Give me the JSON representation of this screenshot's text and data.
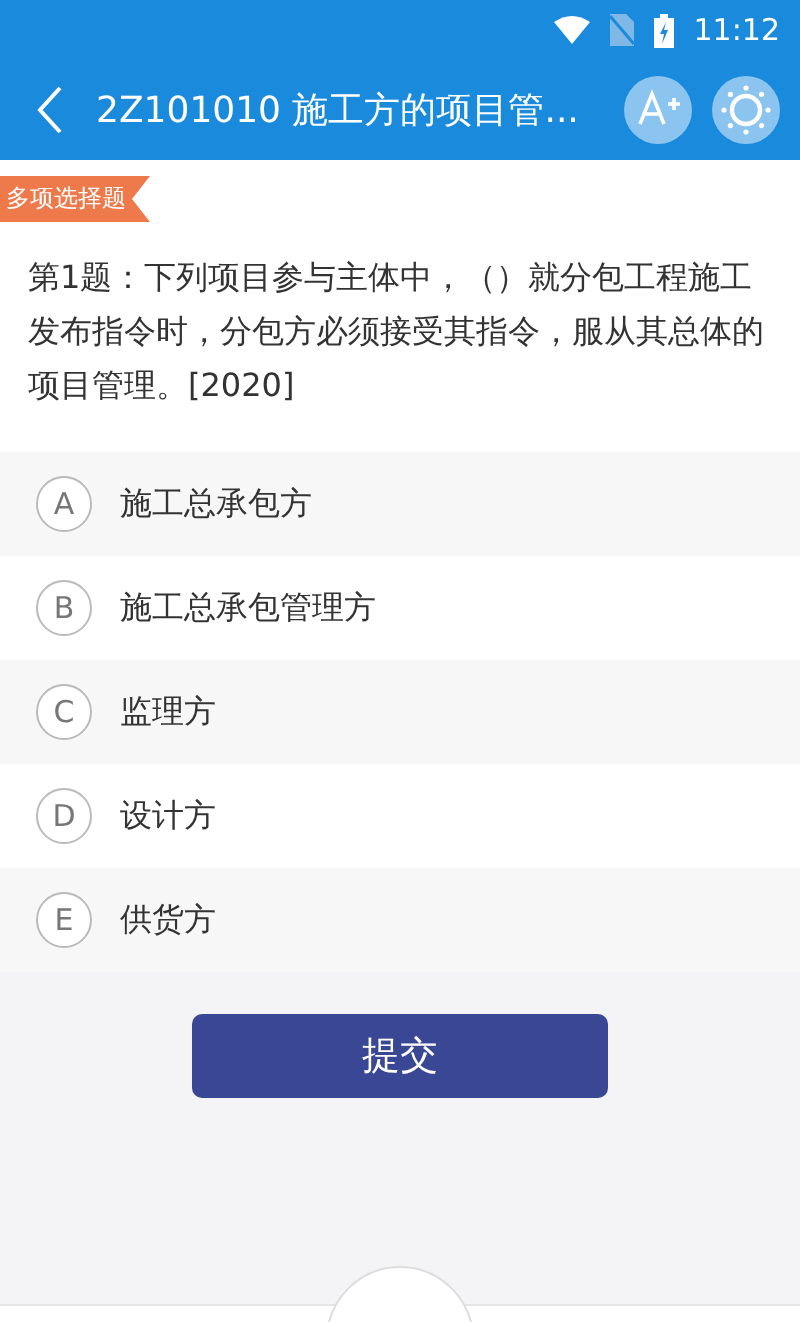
{
  "status_bar": {
    "time": "11:12"
  },
  "header": {
    "title": "2Z101010 施工方的项目管..."
  },
  "question": {
    "type_tag": "多项选择题",
    "text": "第1题：下列项目参与主体中，（）就分包工程施工发布指令时，分包方必须接受其指令，服从其总体的项目管理。[2020]"
  },
  "options": [
    {
      "letter": "A",
      "text": "施工总承包方",
      "selected": false
    },
    {
      "letter": "B",
      "text": "施工总承包管理方",
      "selected": false
    },
    {
      "letter": "C",
      "text": "监理方",
      "selected": false
    },
    {
      "letter": "D",
      "text": "设计方",
      "selected": false
    },
    {
      "letter": "E",
      "text": "供货方",
      "selected": false
    }
  ],
  "submit_button": "提交"
}
